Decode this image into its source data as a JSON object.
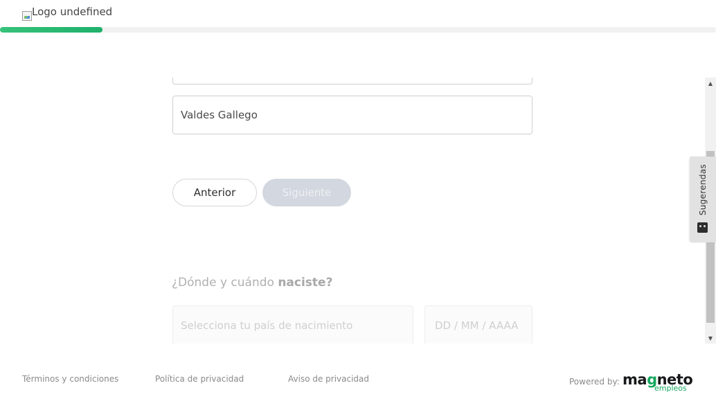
{
  "header": {
    "logo_alt": "Logo undefined",
    "progress_fraction": 0.143
  },
  "form": {
    "surname_value": "Valdes Gallego",
    "prev_button": "Anterior",
    "next_button": "Siguiente",
    "question_prefix": "¿Dónde y cuándo ",
    "question_bold": "naciste?",
    "country_placeholder": "Selecciona tu país de nacimiento",
    "date_placeholder": "DD / MM / AAAA"
  },
  "sidebar_tab": {
    "label": "Sugerendas",
    "icon": "chat-face-icon"
  },
  "footer": {
    "terms": "Términos y condiciones",
    "privacy_policy": "Política de privacidad",
    "privacy_notice": "Aviso de privacidad",
    "powered_by": "Powered by:",
    "brand_name_part1": "ma",
    "brand_name_g": "g",
    "brand_name_part2": "neto",
    "brand_sub": "empleos"
  },
  "colors": {
    "accent_green": "#1fb06a",
    "disabled_button": "#d3d7df"
  }
}
